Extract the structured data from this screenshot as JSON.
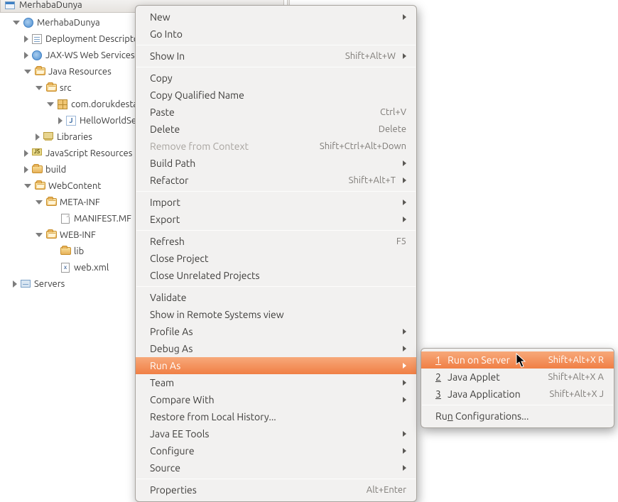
{
  "header": {
    "project_name": "MerhabaDunya"
  },
  "tree": {
    "n0": "MerhabaDunya",
    "n1": "Deployment Descriptor:",
    "n2": "JAX-WS Web Services",
    "n3": "Java Resources",
    "n4": "src",
    "n5": "com.dorukdestan.",
    "n6": "HelloWorldServle",
    "n7": "Libraries",
    "n8": "JavaScript Resources",
    "n9": "build",
    "n10": "WebContent",
    "n11": "META-INF",
    "n12": "MANIFEST.MF",
    "n13": "WEB-INF",
    "n14": "lib",
    "n15": "web.xml",
    "n16": "Servers"
  },
  "menu": {
    "new": "New",
    "go_into": "Go Into",
    "show_in": "Show In",
    "show_in_acc": "Shift+Alt+W",
    "copy": "Copy",
    "copy_qn": "Copy Qualified Name",
    "paste": "Paste",
    "paste_acc": "Ctrl+V",
    "delete": "Delete",
    "delete_acc": "Delete",
    "remove_ctx": "Remove from Context",
    "remove_ctx_acc": "Shift+Ctrl+Alt+Down",
    "build_path": "Build Path",
    "refactor": "Refactor",
    "refactor_acc": "Shift+Alt+T",
    "import": "Import",
    "export": "Export",
    "refresh": "Refresh",
    "refresh_acc": "F5",
    "close_project": "Close Project",
    "close_unrelated": "Close Unrelated Projects",
    "validate": "Validate",
    "show_remote": "Show in Remote Systems view",
    "profile_as": "Profile As",
    "debug_as": "Debug As",
    "run_as": "Run As",
    "team": "Team",
    "compare_with": "Compare With",
    "restore_local": "Restore from Local History...",
    "jee_tools": "Java EE Tools",
    "configure": "Configure",
    "source": "Source",
    "properties": "Properties",
    "properties_acc": "Alt+Enter"
  },
  "submenu": {
    "i1_num": "1",
    "i1": " Run on Server",
    "i1_acc": "Shift+Alt+X R",
    "i2_num": "2",
    "i2": " Java Applet",
    "i2_acc": "Shift+Alt+X A",
    "i3_num": "3",
    "i3": " Java Application",
    "i3_acc": "Shift+Alt+X J",
    "i4_pre": "Ru",
    "i4_u": "n",
    "i4_post": " Configurations..."
  }
}
